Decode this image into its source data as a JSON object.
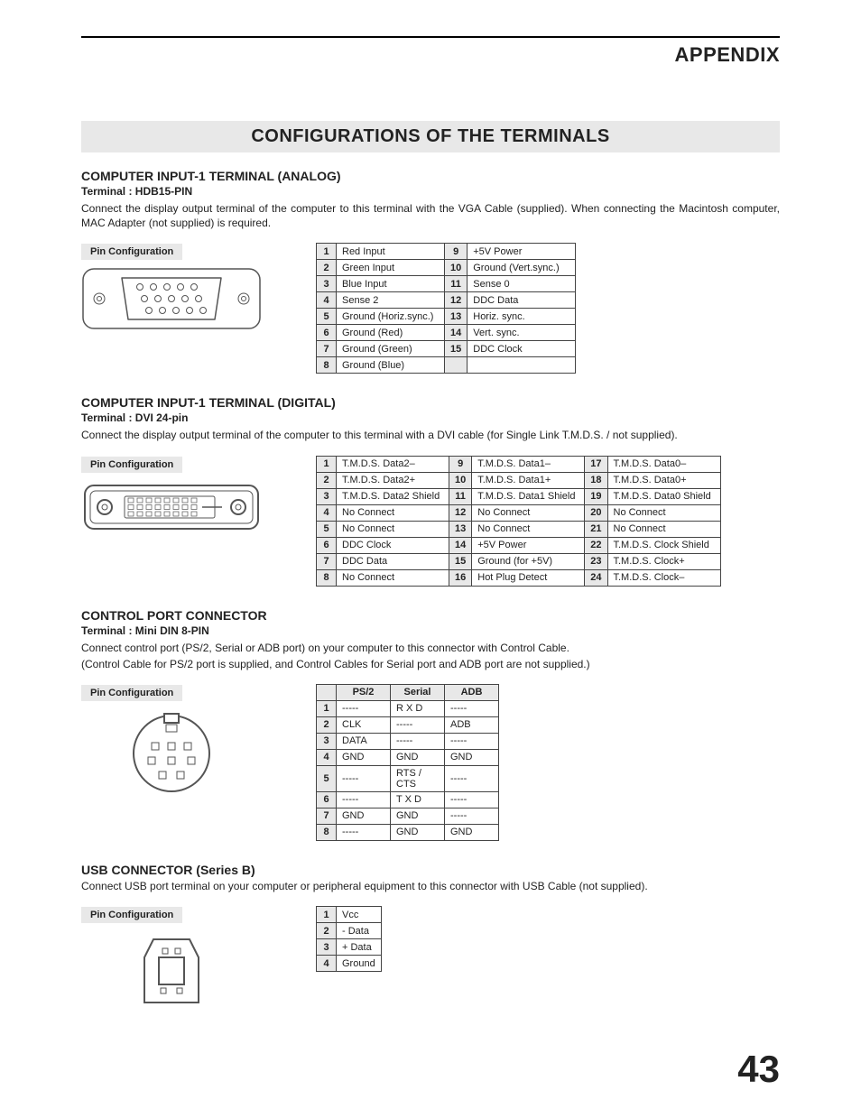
{
  "header": "APPENDIX",
  "title": "CONFIGURATIONS OF THE TERMINALS",
  "pin_config_label": "Pin Configuration",
  "page_number": "43",
  "sections": {
    "analog": {
      "heading": "COMPUTER INPUT-1 TERMINAL (ANALOG)",
      "sub": "Terminal : HDB15-PIN",
      "desc": "Connect the display output terminal of the computer to this terminal with the VGA Cable (supplied).  When connecting the Macintosh computer, MAC Adapter (not supplied) is required.",
      "pins": [
        {
          "n": "1",
          "v": "Red Input"
        },
        {
          "n": "2",
          "v": "Green Input"
        },
        {
          "n": "3",
          "v": "Blue Input"
        },
        {
          "n": "4",
          "v": "Sense 2"
        },
        {
          "n": "5",
          "v": "Ground (Horiz.sync.)"
        },
        {
          "n": "6",
          "v": "Ground (Red)"
        },
        {
          "n": "7",
          "v": "Ground (Green)"
        },
        {
          "n": "8",
          "v": "Ground (Blue)"
        },
        {
          "n": "9",
          "v": "+5V Power"
        },
        {
          "n": "10",
          "v": "Ground (Vert.sync.)"
        },
        {
          "n": "11",
          "v": "Sense 0"
        },
        {
          "n": "12",
          "v": "DDC Data"
        },
        {
          "n": "13",
          "v": "Horiz. sync."
        },
        {
          "n": "14",
          "v": "Vert. sync."
        },
        {
          "n": "15",
          "v": "DDC Clock"
        }
      ]
    },
    "digital": {
      "heading": "COMPUTER INPUT-1 TERMINAL (DIGITAL)",
      "sub": "Terminal : DVI 24-pin",
      "desc": "Connect the display output terminal of the computer to this terminal with a DVI cable (for Single Link T.M.D.S. / not supplied).",
      "pins": [
        {
          "n": "1",
          "v": "T.M.D.S. Data2–"
        },
        {
          "n": "2",
          "v": "T.M.D.S. Data2+"
        },
        {
          "n": "3",
          "v": "T.M.D.S. Data2 Shield"
        },
        {
          "n": "4",
          "v": "No Connect"
        },
        {
          "n": "5",
          "v": "No Connect"
        },
        {
          "n": "6",
          "v": "DDC Clock"
        },
        {
          "n": "7",
          "v": "DDC Data"
        },
        {
          "n": "8",
          "v": "No Connect"
        },
        {
          "n": "9",
          "v": "T.M.D.S. Data1–"
        },
        {
          "n": "10",
          "v": "T.M.D.S. Data1+"
        },
        {
          "n": "11",
          "v": "T.M.D.S. Data1 Shield"
        },
        {
          "n": "12",
          "v": "No Connect"
        },
        {
          "n": "13",
          "v": "No Connect"
        },
        {
          "n": "14",
          "v": "+5V Power"
        },
        {
          "n": "15",
          "v": "Ground (for +5V)"
        },
        {
          "n": "16",
          "v": "Hot Plug Detect"
        },
        {
          "n": "17",
          "v": "T.M.D.S. Data0–"
        },
        {
          "n": "18",
          "v": "T.M.D.S. Data0+"
        },
        {
          "n": "19",
          "v": "T.M.D.S. Data0 Shield"
        },
        {
          "n": "20",
          "v": "No Connect"
        },
        {
          "n": "21",
          "v": "No Connect"
        },
        {
          "n": "22",
          "v": "T.M.D.S. Clock Shield"
        },
        {
          "n": "23",
          "v": "T.M.D.S. Clock+"
        },
        {
          "n": "24",
          "v": "T.M.D.S. Clock–"
        }
      ]
    },
    "control": {
      "heading": "CONTROL PORT CONNECTOR",
      "sub": "Terminal : Mini DIN 8-PIN",
      "desc1": "Connect control port (PS/2, Serial or ADB port) on your computer to this connector with Control Cable.",
      "desc2": "(Control Cable for PS/2 port is supplied, and Control Cables for Serial port and ADB port are not supplied.)",
      "headers": [
        "PS/2",
        "Serial",
        "ADB"
      ],
      "rows": [
        {
          "n": "1",
          "c": [
            "-----",
            "R X D",
            "-----"
          ]
        },
        {
          "n": "2",
          "c": [
            "CLK",
            "-----",
            "ADB"
          ]
        },
        {
          "n": "3",
          "c": [
            "DATA",
            "-----",
            "-----"
          ]
        },
        {
          "n": "4",
          "c": [
            "GND",
            "GND",
            "GND"
          ]
        },
        {
          "n": "5",
          "c": [
            "-----",
            "RTS / CTS",
            "-----"
          ]
        },
        {
          "n": "6",
          "c": [
            "-----",
            "T X D",
            "-----"
          ]
        },
        {
          "n": "7",
          "c": [
            "GND",
            "GND",
            "-----"
          ]
        },
        {
          "n": "8",
          "c": [
            "-----",
            "GND",
            "GND"
          ]
        }
      ]
    },
    "usb": {
      "heading": "USB CONNECTOR (Series B)",
      "desc": "Connect USB port terminal on your computer or peripheral equipment to this connector with USB Cable (not supplied).",
      "pins": [
        {
          "n": "1",
          "v": "Vcc"
        },
        {
          "n": "2",
          "v": "- Data"
        },
        {
          "n": "3",
          "v": "+ Data"
        },
        {
          "n": "4",
          "v": "Ground"
        }
      ]
    }
  }
}
